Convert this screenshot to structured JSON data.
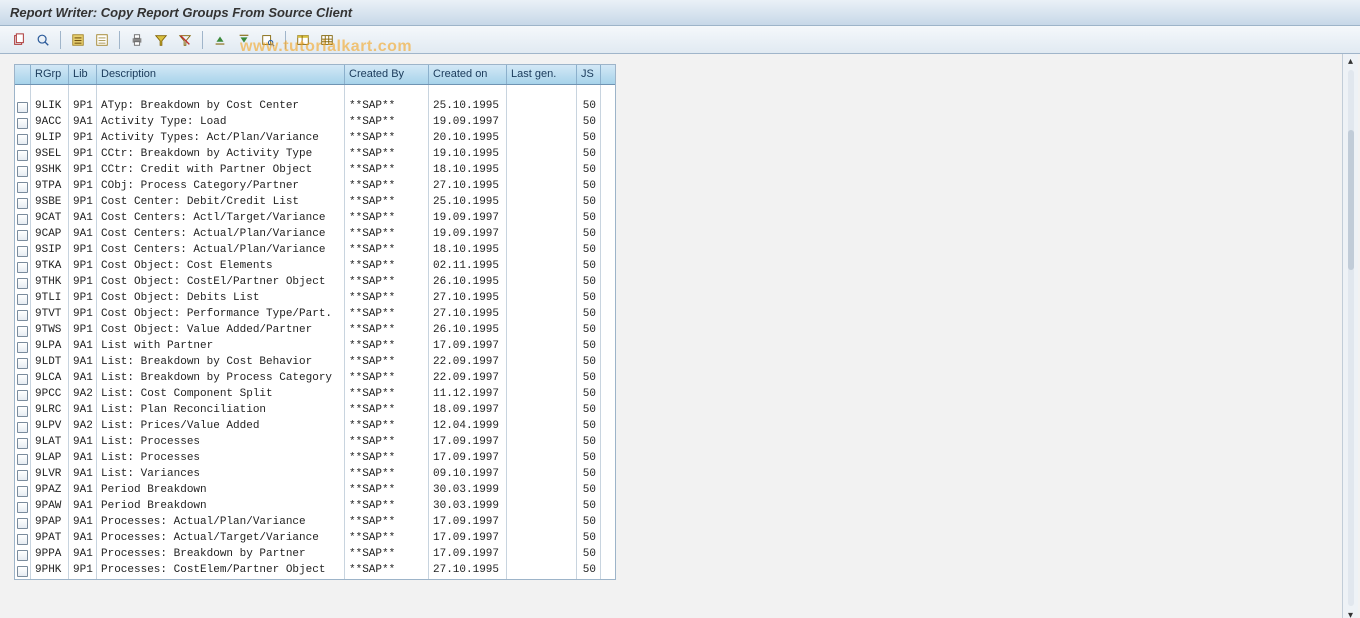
{
  "title": "Report Writer: Copy Report Groups From Source Client",
  "watermark": "www.tutorialkart.com",
  "toolbar_icons": [
    "copy-icon",
    "display-icon",
    "sep",
    "select-all-icon",
    "deselect-all-icon",
    "sep",
    "print-icon",
    "filter-icon",
    "filter-delete-icon",
    "sep",
    "sort-asc-icon",
    "sort-desc-icon",
    "find-icon",
    "sep",
    "layout-icon",
    "grid-icon"
  ],
  "columns": {
    "rgrp": "RGrp",
    "lib": "Lib",
    "desc": "Description",
    "cby": "Created By",
    "con": "Created on",
    "lg": "Last gen.",
    "js": "JS"
  },
  "rows": [
    {
      "rgrp": "9LIK",
      "lib": "9P1",
      "desc": "ATyp: Breakdown by Cost Center",
      "cby": "**SAP**",
      "con": "25.10.1995",
      "lg": "",
      "js": "50"
    },
    {
      "rgrp": "9ACC",
      "lib": "9A1",
      "desc": "Activity Type: Load",
      "cby": "**SAP**",
      "con": "19.09.1997",
      "lg": "",
      "js": "50"
    },
    {
      "rgrp": "9LIP",
      "lib": "9P1",
      "desc": "Activity Types: Act/Plan/Variance",
      "cby": "**SAP**",
      "con": "20.10.1995",
      "lg": "",
      "js": "50"
    },
    {
      "rgrp": "9SEL",
      "lib": "9P1",
      "desc": "CCtr: Breakdown by Activity Type",
      "cby": "**SAP**",
      "con": "19.10.1995",
      "lg": "",
      "js": "50"
    },
    {
      "rgrp": "9SHK",
      "lib": "9P1",
      "desc": "CCtr: Credit with Partner Object",
      "cby": "**SAP**",
      "con": "18.10.1995",
      "lg": "",
      "js": "50"
    },
    {
      "rgrp": "9TPA",
      "lib": "9P1",
      "desc": "CObj: Process Category/Partner",
      "cby": "**SAP**",
      "con": "27.10.1995",
      "lg": "",
      "js": "50"
    },
    {
      "rgrp": "9SBE",
      "lib": "9P1",
      "desc": "Cost Center: Debit/Credit List",
      "cby": "**SAP**",
      "con": "25.10.1995",
      "lg": "",
      "js": "50"
    },
    {
      "rgrp": "9CAT",
      "lib": "9A1",
      "desc": "Cost Centers: Actl/Target/Variance",
      "cby": "**SAP**",
      "con": "19.09.1997",
      "lg": "",
      "js": "50"
    },
    {
      "rgrp": "9CAP",
      "lib": "9A1",
      "desc": "Cost Centers: Actual/Plan/Variance",
      "cby": "**SAP**",
      "con": "19.09.1997",
      "lg": "",
      "js": "50"
    },
    {
      "rgrp": "9SIP",
      "lib": "9P1",
      "desc": "Cost Centers: Actual/Plan/Variance",
      "cby": "**SAP**",
      "con": "18.10.1995",
      "lg": "",
      "js": "50"
    },
    {
      "rgrp": "9TKA",
      "lib": "9P1",
      "desc": "Cost Object: Cost Elements",
      "cby": "**SAP**",
      "con": "02.11.1995",
      "lg": "",
      "js": "50"
    },
    {
      "rgrp": "9THK",
      "lib": "9P1",
      "desc": "Cost Object: CostEl/Partner Object",
      "cby": "**SAP**",
      "con": "26.10.1995",
      "lg": "",
      "js": "50"
    },
    {
      "rgrp": "9TLI",
      "lib": "9P1",
      "desc": "Cost Object: Debits List",
      "cby": "**SAP**",
      "con": "27.10.1995",
      "lg": "",
      "js": "50"
    },
    {
      "rgrp": "9TVT",
      "lib": "9P1",
      "desc": "Cost Object: Performance Type/Part.",
      "cby": "**SAP**",
      "con": "27.10.1995",
      "lg": "",
      "js": "50"
    },
    {
      "rgrp": "9TWS",
      "lib": "9P1",
      "desc": "Cost Object: Value Added/Partner",
      "cby": "**SAP**",
      "con": "26.10.1995",
      "lg": "",
      "js": "50"
    },
    {
      "rgrp": "9LPA",
      "lib": "9A1",
      "desc": "List with Partner",
      "cby": "**SAP**",
      "con": "17.09.1997",
      "lg": "",
      "js": "50"
    },
    {
      "rgrp": "9LDT",
      "lib": "9A1",
      "desc": "List: Breakdown by Cost Behavior",
      "cby": "**SAP**",
      "con": "22.09.1997",
      "lg": "",
      "js": "50"
    },
    {
      "rgrp": "9LCA",
      "lib": "9A1",
      "desc": "List: Breakdown by Process Category",
      "cby": "**SAP**",
      "con": "22.09.1997",
      "lg": "",
      "js": "50"
    },
    {
      "rgrp": "9PCC",
      "lib": "9A2",
      "desc": "List: Cost Component Split",
      "cby": "**SAP**",
      "con": "11.12.1997",
      "lg": "",
      "js": "50"
    },
    {
      "rgrp": "9LRC",
      "lib": "9A1",
      "desc": "List: Plan Reconciliation",
      "cby": "**SAP**",
      "con": "18.09.1997",
      "lg": "",
      "js": "50"
    },
    {
      "rgrp": "9LPV",
      "lib": "9A2",
      "desc": "List: Prices/Value Added",
      "cby": "**SAP**",
      "con": "12.04.1999",
      "lg": "",
      "js": "50"
    },
    {
      "rgrp": "9LAT",
      "lib": "9A1",
      "desc": "List: Processes",
      "cby": "**SAP**",
      "con": "17.09.1997",
      "lg": "",
      "js": "50"
    },
    {
      "rgrp": "9LAP",
      "lib": "9A1",
      "desc": "List: Processes",
      "cby": "**SAP**",
      "con": "17.09.1997",
      "lg": "",
      "js": "50"
    },
    {
      "rgrp": "9LVR",
      "lib": "9A1",
      "desc": "List: Variances",
      "cby": "**SAP**",
      "con": "09.10.1997",
      "lg": "",
      "js": "50"
    },
    {
      "rgrp": "9PAZ",
      "lib": "9A1",
      "desc": "Period Breakdown",
      "cby": "**SAP**",
      "con": "30.03.1999",
      "lg": "",
      "js": "50"
    },
    {
      "rgrp": "9PAW",
      "lib": "9A1",
      "desc": "Period Breakdown",
      "cby": "**SAP**",
      "con": "30.03.1999",
      "lg": "",
      "js": "50"
    },
    {
      "rgrp": "9PAP",
      "lib": "9A1",
      "desc": "Processes: Actual/Plan/Variance",
      "cby": "**SAP**",
      "con": "17.09.1997",
      "lg": "",
      "js": "50"
    },
    {
      "rgrp": "9PAT",
      "lib": "9A1",
      "desc": "Processes: Actual/Target/Variance",
      "cby": "**SAP**",
      "con": "17.09.1997",
      "lg": "",
      "js": "50"
    },
    {
      "rgrp": "9PPA",
      "lib": "9A1",
      "desc": "Processes: Breakdown by Partner",
      "cby": "**SAP**",
      "con": "17.09.1997",
      "lg": "",
      "js": "50"
    },
    {
      "rgrp": "9PHK",
      "lib": "9P1",
      "desc": "Processes: CostElem/Partner Object",
      "cby": "**SAP**",
      "con": "27.10.1995",
      "lg": "",
      "js": "50"
    }
  ]
}
